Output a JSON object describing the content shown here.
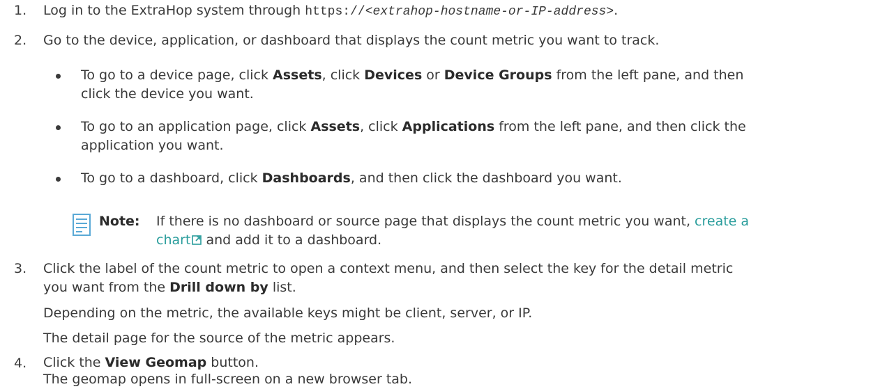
{
  "steps": [
    {
      "number": "1.",
      "prefix": "Log in to the ExtraHop system through ",
      "code_plain": "https://",
      "code_italic": "<extrahop-hostname-or-IP-address>",
      "suffix": "."
    },
    {
      "number": "2.",
      "text": "Go to the device, application, or dashboard that displays the count metric you want to track.",
      "bullets": [
        {
          "t1": "To go to a device page, click ",
          "b1": "Assets",
          "t2": ", click ",
          "b2": "Devices",
          "t3": " or ",
          "b3": "Device Groups",
          "t4": " from the left pane, and then",
          "line2": "click the device you want."
        },
        {
          "t1": "To go to an application page, click ",
          "b1": "Assets",
          "t2": ", click ",
          "b2": "Applications",
          "t3": " from the left pane, and then click the",
          "line2": "application you want."
        },
        {
          "t1": "To go to a dashboard, click ",
          "b1": "Dashboards",
          "t2": ", and then click the dashboard you want."
        }
      ],
      "note": {
        "label": "Note:",
        "text_line1": "If there is no dashboard or source page that displays the count metric you want, ",
        "link_part1": "create a",
        "link_part2": "chart",
        "text_after_link": " and add it to a dashboard."
      }
    },
    {
      "number": "3.",
      "line1": "Click the label of the count metric to open a context menu, and then select the key for the detail metric",
      "line2_prefix": "you want from the ",
      "line2_bold": "Drill down by",
      "line2_suffix": " list.",
      "para1": "Depending on the metric, the available keys might be client, server, or IP.",
      "para2": "The detail page for the source of the metric appears."
    },
    {
      "number": "4.",
      "prefix": "Click the ",
      "bold": "View Geomap",
      "suffix": " button.",
      "line2": "The geomap opens in full-screen on a new browser tab."
    }
  ],
  "colors": {
    "text": "#3a3a3a",
    "link": "#2a9d9c",
    "note_icon": "#5aa9d6"
  },
  "icons": {
    "note": "note-icon",
    "external_link": "external-link-icon"
  }
}
